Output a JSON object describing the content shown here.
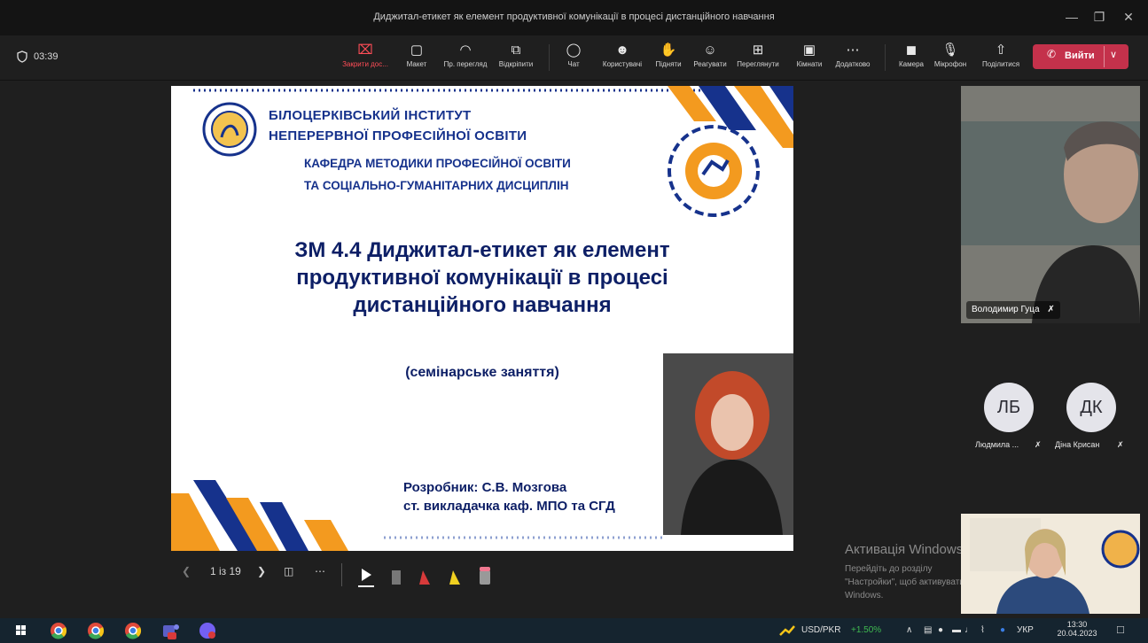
{
  "window": {
    "title": "Диджитал-етикет як елемент продуктивної комунікації в процесі дистанційного навчання"
  },
  "meeting": {
    "timer": "03:39"
  },
  "toolbar": {
    "stop_share": "Закрити дос...",
    "layout": "Макет",
    "preview": "Пр. перегляд",
    "unpin": "Відкріпити",
    "chat": "Чат",
    "people": "Користувачі",
    "raise": "Підняти",
    "react": "Реагувати",
    "view": "Переглянути",
    "rooms": "Кімнати",
    "more": "Додатково",
    "camera": "Камера",
    "mic": "Мікрофон",
    "share": "Поділитися",
    "leave": "Вийти"
  },
  "slide": {
    "institute_line1": "БІЛОЦЕРКІВСЬКИЙ ІНСТИТУТ",
    "institute_line2": "НЕПЕРЕРВНОЇ ПРОФЕСІЙНОЇ ОСВІТИ",
    "dept_line1": "КАФЕДРА МЕТОДИКИ ПРОФЕСІЙНОЇ ОСВІТИ",
    "dept_line2": "ТА СОЦІАЛЬНО-ГУМАНІТАРНИХ ДИСЦИПЛІН",
    "title_line1": "ЗМ 4.4 Диджитал-етикет як елемент",
    "title_line2": "продуктивної комунікації в процесі",
    "title_line3": "дистанційного навчання",
    "subtitle": "(семінарське заняття)",
    "author_line1": "Розробник: С.В. Мозгова",
    "author_line2": "ст. викладачка каф. МПО та СГД"
  },
  "slide_controls": {
    "page": "1 із 19"
  },
  "participants": {
    "video_name": "Володимир Гуца",
    "p1_initials": "ЛБ",
    "p1_name": "Людмила ...",
    "p2_initials": "ДК",
    "p2_name": "Діна Крисан"
  },
  "activation": {
    "title": "Активація Windows",
    "text": "Перейдіть до розділу \"Настройки\", щоб активувати Windows."
  },
  "taskbar": {
    "ticker": "USD/PKR",
    "change": "+1.50%",
    "lang": "УКР",
    "time": "13:30",
    "date": "20.04.2023"
  },
  "colors": {
    "leave": "#c4314b",
    "accent_red": "#ff4d57",
    "slide_navy": "#0d1f66",
    "stripe_orange": "#f39a1f"
  }
}
